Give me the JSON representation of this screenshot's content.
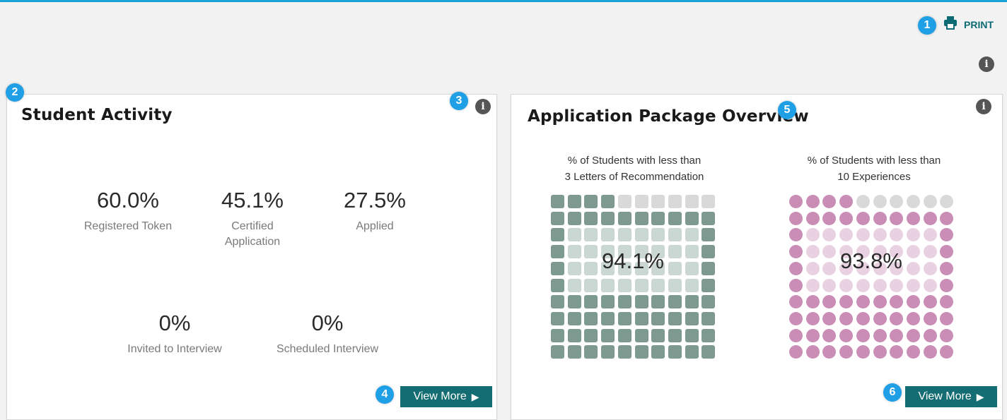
{
  "toolbar": {
    "print_label": "PRINT",
    "print_icon": "printer-icon"
  },
  "tour_badges": [
    "1",
    "2",
    "3",
    "4",
    "5",
    "6"
  ],
  "student_activity": {
    "title": "Student Activity",
    "stats": [
      {
        "value": "60.0%",
        "label": "Registered Token"
      },
      {
        "value": "45.1%",
        "label": "Certified Application"
      },
      {
        "value": "27.5%",
        "label": "Applied"
      },
      {
        "value": "0%",
        "label": "Invited to Interview"
      },
      {
        "value": "0%",
        "label": "Scheduled Interview"
      }
    ],
    "view_more_label": "View More"
  },
  "application_package": {
    "title": "Application Package Overview",
    "view_more_label": "View More",
    "charts": [
      {
        "caption_line1": "% of Students with less than",
        "caption_line2": "3 Letters of Recommendation",
        "percent_label": "94.1%",
        "value": 94.1,
        "shape": "square",
        "filled_color": "#7e9a90",
        "empty_color": "#d9d9d9"
      },
      {
        "caption_line1": "% of Students with less than",
        "caption_line2": "10 Experiences",
        "percent_label": "93.8%",
        "value": 93.8,
        "shape": "circle",
        "filled_color": "#c98db6",
        "empty_color": "#d9d9d9"
      }
    ]
  },
  "colors": {
    "accent": "#136d73",
    "badge": "#1e9fe6",
    "top_line": "#1aa3d9"
  }
}
